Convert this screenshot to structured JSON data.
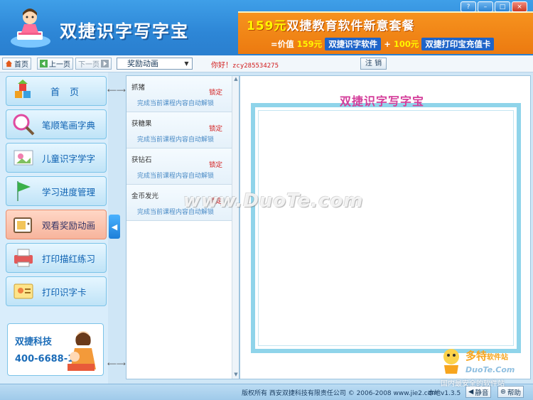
{
  "header": {
    "app_title": "双捷识字写字宝",
    "banner": {
      "price_prefix": "159元",
      "line1": "双捷教育软件新意套餐",
      "eq": "=价值",
      "price_a": "159元",
      "product_a": "双捷识字软件",
      "plus": "+",
      "price_b": "100元",
      "product_b": "双捷打印宝充值卡"
    },
    "window_controls": [
      "?",
      "–",
      "□",
      "×"
    ]
  },
  "toolbar": {
    "home": "首页",
    "prev": "上一页",
    "next": "下一页",
    "select_value": "奖励动画",
    "greeting": "你好！",
    "username": "zcy285534275",
    "logout": "注 销"
  },
  "nav": {
    "items": [
      {
        "label": "首页"
      },
      {
        "label": "笔顺笔画字典"
      },
      {
        "label": "儿童识字学字"
      },
      {
        "label": "学习进度管理"
      },
      {
        "label": "观看奖励动画"
      },
      {
        "label": "打印描红练习"
      },
      {
        "label": "打印识字卡"
      }
    ],
    "promo_company": "双捷科技",
    "promo_phone": "400-6688-186"
  },
  "awards": [
    {
      "name": "抓猪",
      "status": "锁定",
      "desc": "完成当前课程内容自动解锁"
    },
    {
      "name": "获糖果",
      "status": "锁定",
      "desc": "完成当前课程内容自动解锁"
    },
    {
      "name": "获钻石",
      "status": "锁定",
      "desc": "完成当前课程内容自动解锁"
    },
    {
      "name": "金币发光",
      "status": "锁定",
      "desc": "完成当前课程内容自动解锁"
    }
  ],
  "preview": {
    "title": "双捷识字写字宝"
  },
  "watermark": "www.DuoTe.com",
  "status": {
    "copyright": "版权所有  西安双捷科技有限责任公司 © 2006-2008  www.jie2.com",
    "version": "本地v1.3.5",
    "mute": "静音",
    "help": "帮助"
  },
  "corner_logo": {
    "brand": "多特",
    "brand_suffix": "软件站",
    "site": "DuoTe.Com",
    "tagline": "国内最安全的软件站"
  },
  "colors": {
    "header_blue": "#2d86d6",
    "banner_orange": "#f6921e",
    "nav_active": "#f7b49c",
    "lock_red": "#d42222",
    "frame_cyan": "#8fd4ea",
    "title_pink": "#d43d9a"
  }
}
